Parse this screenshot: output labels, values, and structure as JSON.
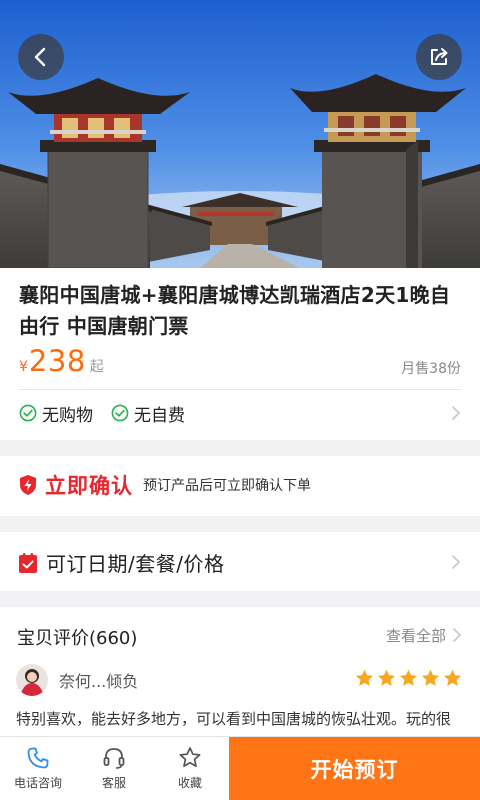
{
  "product": {
    "title": "襄阳中国唐城+襄阳唐城博达凯瑞酒店2天1晚自由行 中国唐朝门票",
    "price_currency": "¥",
    "price": "238",
    "price_suffix": "起",
    "monthly_sales": "月售38份",
    "tags": [
      "无购物",
      "无自费"
    ]
  },
  "confirm": {
    "title": "立即确认",
    "description": "预订产品后可立即确认下单"
  },
  "dates": {
    "label": "可订日期/套餐/价格"
  },
  "reviews": {
    "title": "宝贝评价(660)",
    "view_all": "查看全部",
    "items": [
      {
        "user": "奈何...倾负",
        "rating": 5,
        "text": "特别喜欢，能去好多地方，可以看到中国唐城的恢弘壮观。玩的很开心，导游也很热情"
      }
    ]
  },
  "bottom_bar": {
    "phone": "电话咨询",
    "service": "客服",
    "favorite": "收藏",
    "book": "开始预订"
  },
  "colors": {
    "accent_orange": "#ff7415",
    "price_orange": "#ff6a0c",
    "confirm_red": "#e8262e",
    "check_green": "#2bb24c",
    "phone_blue": "#2f8df0",
    "star_gold": "#f7a823"
  }
}
